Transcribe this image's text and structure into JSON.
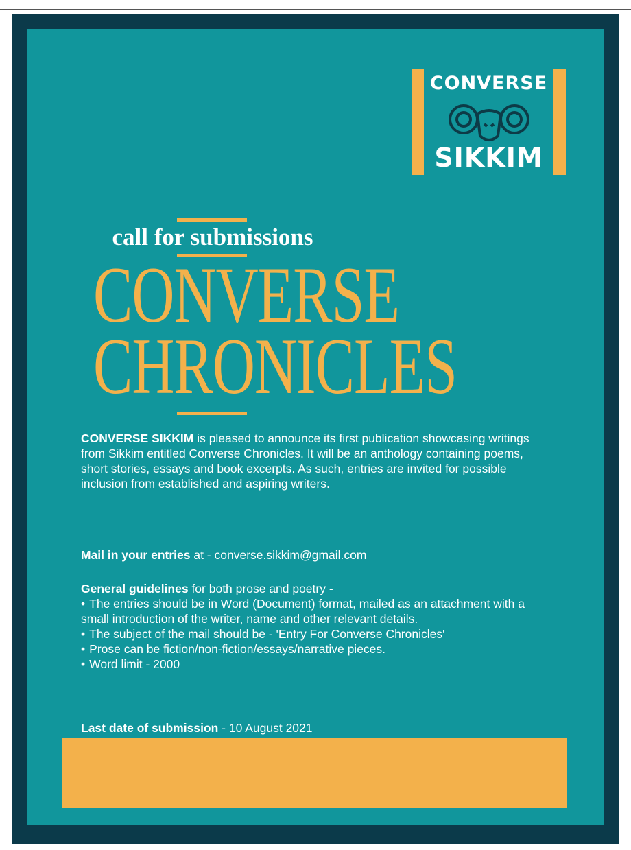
{
  "colors": {
    "frame": "#0b3a4a",
    "panel": "#11969c",
    "accent": "#f3b14b",
    "text": "#ffffff"
  },
  "logo": {
    "line1": "CONVERSE",
    "line2": "SIKKIM",
    "emblem_icon": "ram-head-icon"
  },
  "heading": {
    "call_for": "call for submissions",
    "title_line1": "CONVERSE",
    "title_line2": "CHRONICLES"
  },
  "intro": {
    "lead": "CONVERSE SIKKIM",
    "text": " is pleased to announce its first publication showcasing writings from Sikkim entitled Converse Chronicles. It will be an anthology containing poems, short stories, essays and book excerpts. As such, entries are invited for possible inclusion from established and aspiring writers."
  },
  "mail": {
    "label": "Mail in your entries",
    "text": " at  - converse.sikkim@gmail.com"
  },
  "guidelines": {
    "label": "General guidelines",
    "text": " for both prose and poetry -",
    "bullets": [
      "The entries should be in Word (Document) format, mailed as an attachment with a small introduction of the writer, name and other relevant details.",
      "The subject of the mail should be  - 'Entry For Converse Chronicles'",
      "Prose can be fiction/non-fiction/essays/narrative pieces.",
      "Word limit - 2000"
    ]
  },
  "deadline": {
    "label": "Last date of submission",
    "text": " - 10 August 2021"
  }
}
